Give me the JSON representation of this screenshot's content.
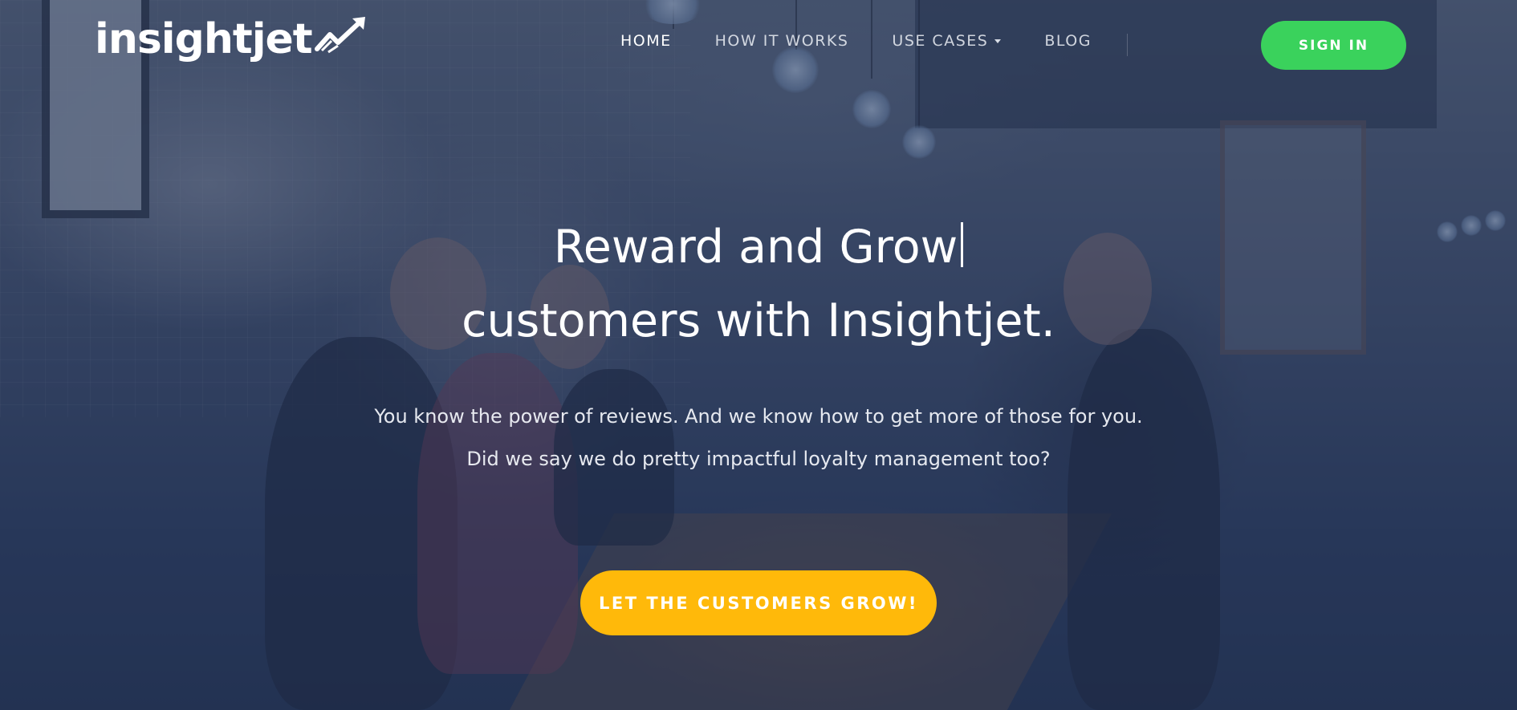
{
  "brand": {
    "logo_text": "insightjet",
    "logo_icon": "trend-arrow-icon"
  },
  "nav": {
    "items": [
      {
        "label": "HOME",
        "active": true
      },
      {
        "label": "HOW IT WORKS",
        "active": false
      },
      {
        "label": "USE CASES",
        "active": false,
        "has_dropdown": true
      },
      {
        "label": "BLOG",
        "active": false
      }
    ],
    "signin_label": "SIGN IN"
  },
  "hero": {
    "headline_line1": "Reward and Grow",
    "headline_line2": "customers with Insightjet.",
    "subtext_line1": "You know the power of reviews. And we know how to get more of those for you.",
    "subtext_line2": "Did we say we do pretty impactful loyalty management too?",
    "cta_label": "LET THE CUSTOMERS GROW!"
  },
  "colors": {
    "signin_bg": "#3ad25c",
    "cta_bg": "#ffb90a",
    "overlay": "#233458"
  }
}
